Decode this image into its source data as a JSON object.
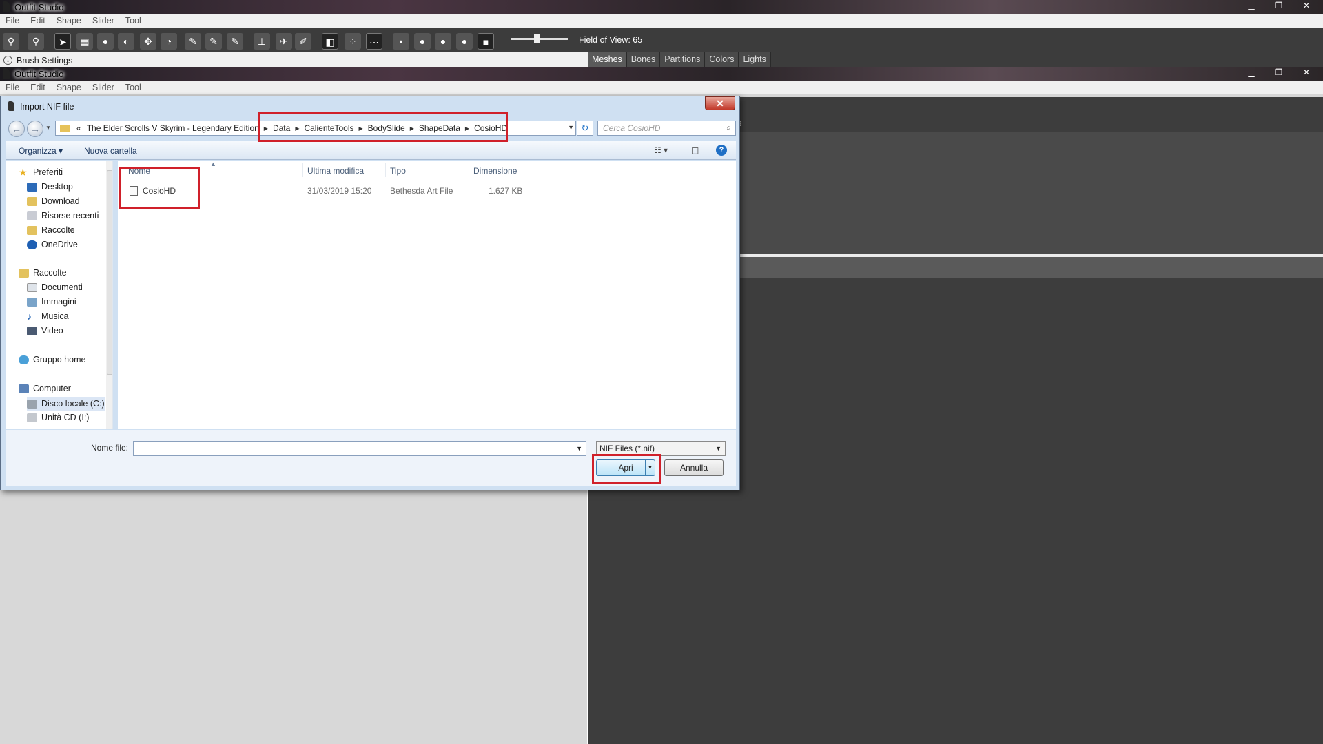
{
  "back_window": {
    "title": "Outfit Studio",
    "menu": [
      "File",
      "Edit",
      "Shape",
      "Slider",
      "Tool"
    ],
    "fov_label": "Field of View: 65",
    "brush_settings": "Brush Settings",
    "tabs": [
      "Meshes",
      "Bones",
      "Partitions",
      "Colors",
      "Lights"
    ]
  },
  "front_window": {
    "title": "Outfit Studio",
    "menu": [
      "File",
      "Edit",
      "Shape",
      "Slider",
      "Tool"
    ],
    "partial_tab": "ights"
  },
  "dialog": {
    "title": "Import NIF file",
    "breadcrumb": {
      "prefix": "«",
      "items": [
        "The Elder Scrolls V Skyrim - Legendary Edition",
        "Data",
        "CalienteTools",
        "BodySlide",
        "ShapeData",
        "CosioHD"
      ]
    },
    "search_placeholder": "Cerca CosioHD",
    "commands": {
      "organize": "Organizza",
      "new_folder": "Nuova cartella"
    },
    "nav": {
      "favorites": "Preferiti",
      "favorites_items": [
        "Desktop",
        "Download",
        "Risorse recenti",
        "Raccolte",
        "OneDrive"
      ],
      "libraries": "Raccolte",
      "libraries_items": [
        "Documenti",
        "Immagini",
        "Musica",
        "Video"
      ],
      "homegroup": "Gruppo home",
      "computer": "Computer",
      "computer_items": [
        "Disco locale (C:)",
        "Unità CD (I:)"
      ]
    },
    "columns": {
      "name": "Nome",
      "modified": "Ultima modifica",
      "type": "Tipo",
      "size": "Dimensione"
    },
    "files": [
      {
        "name": "CosioHD",
        "modified": "31/03/2019 15:20",
        "type": "Bethesda Art File",
        "size": "1.627 KB"
      }
    ],
    "filename_label": "Nome file:",
    "filename_value": "",
    "filetype": "NIF Files (*.nif)",
    "open_button": "Apri",
    "cancel_button": "Annulla"
  },
  "colors": {
    "highlight": "#d0202a",
    "panel_dark": "#3d3d3d"
  }
}
